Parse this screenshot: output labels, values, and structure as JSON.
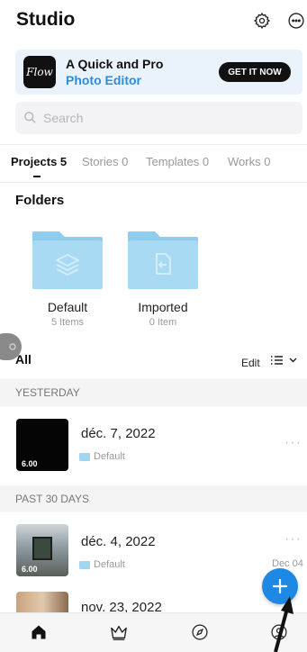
{
  "header": {
    "title": "Studio",
    "settings_icon": "gear-icon",
    "more_icon": "more-circle-icon"
  },
  "promo": {
    "logo_text": "Flow",
    "line1": "A Quick and Pro",
    "line2": "Photo Editor",
    "button": "GET IT NOW",
    "accent": "#2a8ee0"
  },
  "search": {
    "placeholder": "Search",
    "value": ""
  },
  "tabs": [
    {
      "label": "Projects 5",
      "active": true
    },
    {
      "label": "Stories 0",
      "active": false
    },
    {
      "label": "Templates 0",
      "active": false
    },
    {
      "label": "Works 0",
      "active": false
    }
  ],
  "folders_section": {
    "title": "Folders",
    "items": [
      {
        "name": "Default",
        "count": "5 Items",
        "icon": "layers-icon"
      },
      {
        "name": "Imported",
        "count": "0 Item",
        "icon": "import-icon"
      }
    ]
  },
  "all_section": {
    "title": "All",
    "edit": "Edit",
    "view_icon": "list-view-icon"
  },
  "groups": [
    {
      "header": "YESTERDAY",
      "projects": [
        {
          "date": "déc. 7, 2022",
          "folder": "Default",
          "duration": "6.00",
          "side": ""
        }
      ]
    },
    {
      "header": "PAST 30 DAYS",
      "projects": [
        {
          "date": "déc. 4, 2022",
          "folder": "Default",
          "duration": "6.00",
          "side": "Dec 04"
        },
        {
          "date": "nov. 23, 2022",
          "folder": "",
          "duration": "",
          "side": ""
        }
      ]
    }
  ],
  "fab": {
    "icon": "plus-icon",
    "color": "#1e88e5"
  },
  "bottom_nav": [
    {
      "name": "home",
      "icon": "home-icon",
      "active": true
    },
    {
      "name": "premium",
      "icon": "crown-icon",
      "active": false
    },
    {
      "name": "explore",
      "icon": "compass-icon",
      "active": false
    },
    {
      "name": "profile",
      "icon": "profile-icon",
      "active": false
    }
  ],
  "colors": {
    "folder": "#a9daf3",
    "folder_tab": "#8fcdef",
    "accent": "#1e88e5"
  }
}
